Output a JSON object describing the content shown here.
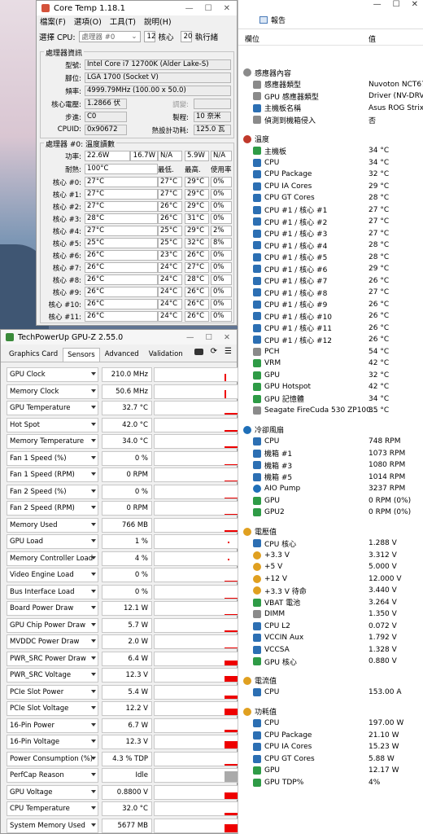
{
  "coretemp": {
    "title": "Core Temp 1.18.1",
    "menu": [
      "檔案(F)",
      "選項(O)",
      "工具(T)",
      "說明(H)"
    ],
    "sel_label": "選擇 CPU:",
    "sel_value": "處理器 #0",
    "cores": "12",
    "cores_label": "核心",
    "threads": "20",
    "threads_label": "執行緒",
    "info_title": "處理器資訊",
    "model_l": "型號:",
    "model": "Intel Core i7 12700K (Alder Lake-S)",
    "socket_l": "腳位:",
    "socket": "LGA 1700 (Socket V)",
    "freq_l": "頻率:",
    "freq": "4999.79MHz (100.00 x 50.0)",
    "vid_l": "核心電壓:",
    "vid": "1.2866 伏",
    "mod_l": "調變:",
    "step_l": "步進:",
    "step": "C0",
    "lith_l": "製程:",
    "lith": "10 奈米",
    "cpuid_l": "CPUID:",
    "cpuid": "0x90672",
    "tdp_l": "熱設計功耗:",
    "tdp": "125.0 瓦",
    "temp_title": "處理器 #0: 溫度讀數",
    "power_l": "功率:",
    "power": [
      "22.6W",
      "16.7W",
      "N/A",
      "5.9W",
      "N/A"
    ],
    "tj_l": "耐熱:",
    "tj": "100°C",
    "hdr": [
      "最低.",
      "最高.",
      "使用率"
    ],
    "rows": [
      [
        "核心 #0:",
        "27°C",
        "27°C",
        "29°C",
        "0%"
      ],
      [
        "核心 #1:",
        "27°C",
        "27°C",
        "29°C",
        "0%"
      ],
      [
        "核心 #2:",
        "27°C",
        "26°C",
        "29°C",
        "0%"
      ],
      [
        "核心 #3:",
        "28°C",
        "26°C",
        "31°C",
        "0%"
      ],
      [
        "核心 #4:",
        "27°C",
        "25°C",
        "29°C",
        "2%"
      ],
      [
        "核心 #5:",
        "25°C",
        "25°C",
        "32°C",
        "8%"
      ],
      [
        "核心 #6:",
        "26°C",
        "23°C",
        "26°C",
        "0%"
      ],
      [
        "核心 #7:",
        "26°C",
        "24°C",
        "27°C",
        "0%"
      ],
      [
        "核心 #8:",
        "26°C",
        "24°C",
        "28°C",
        "0%"
      ],
      [
        "核心 #9:",
        "26°C",
        "24°C",
        "26°C",
        "0%"
      ],
      [
        "核心 #10:",
        "26°C",
        "24°C",
        "26°C",
        "0%"
      ],
      [
        "核心 #11:",
        "26°C",
        "24°C",
        "26°C",
        "0%"
      ]
    ]
  },
  "gpuz": {
    "title": "TechPowerUp GPU-Z 2.55.0",
    "tabs": [
      "Graphics Card",
      "Sensors",
      "Advanced",
      "Validation"
    ],
    "sensors": [
      {
        "n": "GPU Clock",
        "v": "210.0 MHz",
        "g": 0.55,
        "k": "spk"
      },
      {
        "n": "Memory Clock",
        "v": "50.6 MHz",
        "g": 0.6,
        "k": "spk"
      },
      {
        "n": "GPU Temperature",
        "v": "32.7 °C",
        "g": 0.1,
        "k": "ln"
      },
      {
        "n": "Hot Spot",
        "v": "42.0 °C",
        "g": 0.12,
        "k": "ln"
      },
      {
        "n": "Memory Temperature",
        "v": "34.0 °C",
        "g": 0.1,
        "k": "ln"
      },
      {
        "n": "Fan 1 Speed (%)",
        "v": "0 %",
        "g": 0,
        "k": "ln"
      },
      {
        "n": "Fan 1 Speed (RPM)",
        "v": "0 RPM",
        "g": 0,
        "k": "ln"
      },
      {
        "n": "Fan 2 Speed (%)",
        "v": "0 %",
        "g": 0,
        "k": "ln"
      },
      {
        "n": "Fan 2 Speed (RPM)",
        "v": "0 RPM",
        "g": 0,
        "k": "ln"
      },
      {
        "n": "Memory Used",
        "v": "766 MB",
        "g": 0.1,
        "k": "ln"
      },
      {
        "n": "GPU Load",
        "v": "1 %",
        "g": 0.05,
        "k": "dot"
      },
      {
        "n": "Memory Controller Load",
        "v": "4 %",
        "g": 0.05,
        "k": "dot"
      },
      {
        "n": "Video Engine Load",
        "v": "0 %",
        "g": 0,
        "k": "ln"
      },
      {
        "n": "Bus Interface Load",
        "v": "0 %",
        "g": 0,
        "k": "ln"
      },
      {
        "n": "Board Power Draw",
        "v": "12.1 W",
        "g": 0.08,
        "k": "ln"
      },
      {
        "n": "GPU Chip Power Draw",
        "v": "5.7 W",
        "g": 0.08,
        "k": "ln"
      },
      {
        "n": "MVDDC Power Draw",
        "v": "2.0 W",
        "g": 0.08,
        "k": "ln"
      },
      {
        "n": "PWR_SRC Power Draw",
        "v": "6.4 W",
        "g": 0.35,
        "k": "blk"
      },
      {
        "n": "PWR_SRC Voltage",
        "v": "12.3 V",
        "g": 0.45,
        "k": "blk"
      },
      {
        "n": "PCIe Slot Power",
        "v": "5.4 W",
        "g": 0.2,
        "k": "ln"
      },
      {
        "n": "PCIe Slot Voltage",
        "v": "12.2 V",
        "g": 0.5,
        "k": "blk"
      },
      {
        "n": "16-Pin Power",
        "v": "6.7 W",
        "g": 0.15,
        "k": "ln"
      },
      {
        "n": "16-Pin Voltage",
        "v": "12.3 V",
        "g": 0.55,
        "k": "blk"
      },
      {
        "n": "Power Consumption (%)",
        "v": "4.3 % TDP",
        "g": 0.1,
        "k": "ln"
      },
      {
        "n": "PerfCap Reason",
        "v": "Idle",
        "g": 0.8,
        "k": "gray"
      },
      {
        "n": "GPU Voltage",
        "v": "0.8800 V",
        "g": 0.45,
        "k": "blk"
      },
      {
        "n": "CPU Temperature",
        "v": "32.0 °C",
        "g": 0.2,
        "k": "ln"
      },
      {
        "n": "System Memory Used",
        "v": "5677 MB",
        "g": 0.6,
        "k": "blk"
      }
    ]
  },
  "hwinfo": {
    "report": "報告",
    "col_sensor": "感測器",
    "col_value": "值",
    "top_fields": "欄位",
    "top_value": "值",
    "items": [
      {
        "t": "sec",
        "n": "感應器內容",
        "v": "",
        "i": "gray"
      },
      {
        "n": "感應器類型",
        "v": "Nuvoton NCT679",
        "i": "gray"
      },
      {
        "n": "GPU 感應器類型",
        "v": "Driver (NV-DRV)",
        "i": "gray"
      },
      {
        "n": "主機板名稱",
        "v": "Asus ROG Strix Z6",
        "i": "chip"
      },
      {
        "n": "偵測到機箱侵入",
        "v": "否",
        "i": "gray"
      },
      {
        "t": "gap"
      },
      {
        "t": "sec",
        "n": "溫度",
        "v": "",
        "i": "tmp"
      },
      {
        "n": "主機板",
        "v": "34 °C",
        "i": "grn"
      },
      {
        "n": "CPU",
        "v": "34 °C",
        "i": "chip"
      },
      {
        "n": "CPU Package",
        "v": "32 °C",
        "i": "chip"
      },
      {
        "n": "CPU IA Cores",
        "v": "29 °C",
        "i": "chip"
      },
      {
        "n": "CPU GT Cores",
        "v": "28 °C",
        "i": "chip"
      },
      {
        "n": "CPU #1 / 核心 #1",
        "v": "27 °C",
        "i": "chip"
      },
      {
        "n": "CPU #1 / 核心 #2",
        "v": "27 °C",
        "i": "chip"
      },
      {
        "n": "CPU #1 / 核心 #3",
        "v": "27 °C",
        "i": "chip"
      },
      {
        "n": "CPU #1 / 核心 #4",
        "v": "28 °C",
        "i": "chip"
      },
      {
        "n": "CPU #1 / 核心 #5",
        "v": "28 °C",
        "i": "chip"
      },
      {
        "n": "CPU #1 / 核心 #6",
        "v": "29 °C",
        "i": "chip"
      },
      {
        "n": "CPU #1 / 核心 #7",
        "v": "26 °C",
        "i": "chip"
      },
      {
        "n": "CPU #1 / 核心 #8",
        "v": "27 °C",
        "i": "chip"
      },
      {
        "n": "CPU #1 / 核心 #9",
        "v": "26 °C",
        "i": "chip"
      },
      {
        "n": "CPU #1 / 核心 #10",
        "v": "26 °C",
        "i": "chip"
      },
      {
        "n": "CPU #1 / 核心 #11",
        "v": "26 °C",
        "i": "chip"
      },
      {
        "n": "CPU #1 / 核心 #12",
        "v": "26 °C",
        "i": "chip"
      },
      {
        "n": "PCH",
        "v": "54 °C",
        "i": "gray"
      },
      {
        "n": "VRM",
        "v": "42 °C",
        "i": "grn"
      },
      {
        "n": "GPU",
        "v": "32 °C",
        "i": "grn"
      },
      {
        "n": "GPU Hotspot",
        "v": "42 °C",
        "i": "grn"
      },
      {
        "n": "GPU 記憶體",
        "v": "34 °C",
        "i": "grn"
      },
      {
        "n": "Seagate FireCuda 530 ZP100...",
        "v": "35 °C",
        "i": "gray"
      },
      {
        "t": "gap"
      },
      {
        "t": "sec",
        "n": "冷卻風扇",
        "v": "",
        "i": "fan"
      },
      {
        "n": "CPU",
        "v": "748 RPM",
        "i": "chip"
      },
      {
        "n": "機箱 #1",
        "v": "1073 RPM",
        "i": "chip"
      },
      {
        "n": "機箱 #3",
        "v": "1080 RPM",
        "i": "chip"
      },
      {
        "n": "機箱 #5",
        "v": "1014 RPM",
        "i": "chip"
      },
      {
        "n": "AIO Pump",
        "v": "3237 RPM",
        "i": "fan"
      },
      {
        "n": "GPU",
        "v": "0 RPM  (0%)",
        "i": "grn"
      },
      {
        "n": "GPU2",
        "v": "0 RPM  (0%)",
        "i": "grn"
      },
      {
        "t": "gap"
      },
      {
        "t": "sec",
        "n": "電壓值",
        "v": "",
        "i": "pw"
      },
      {
        "n": "CPU 核心",
        "v": "1.288 V",
        "i": "chip"
      },
      {
        "n": "+3.3 V",
        "v": "3.312 V",
        "i": "pw"
      },
      {
        "n": "+5 V",
        "v": "5.000 V",
        "i": "pw"
      },
      {
        "n": "+12 V",
        "v": "12.000 V",
        "i": "pw"
      },
      {
        "n": "+3.3 V 待命",
        "v": "3.440 V",
        "i": "pw"
      },
      {
        "n": "VBAT 電池",
        "v": "3.264 V",
        "i": "grn"
      },
      {
        "n": "DIMM",
        "v": "1.350 V",
        "i": "gray"
      },
      {
        "n": "CPU L2",
        "v": "0.072 V",
        "i": "chip"
      },
      {
        "n": "VCCIN Aux",
        "v": "1.792 V",
        "i": "chip"
      },
      {
        "n": "VCCSA",
        "v": "1.328 V",
        "i": "chip"
      },
      {
        "n": "GPU 核心",
        "v": "0.880 V",
        "i": "grn"
      },
      {
        "t": "gap"
      },
      {
        "t": "sec",
        "n": "電流值",
        "v": "",
        "i": "pw"
      },
      {
        "n": "CPU",
        "v": "153.00 A",
        "i": "chip"
      },
      {
        "t": "gap"
      },
      {
        "t": "sec",
        "n": "功耗值",
        "v": "",
        "i": "pw"
      },
      {
        "n": "CPU",
        "v": "197.00 W",
        "i": "chip"
      },
      {
        "n": "CPU Package",
        "v": "21.10 W",
        "i": "chip"
      },
      {
        "n": "CPU IA Cores",
        "v": "15.23 W",
        "i": "chip"
      },
      {
        "n": "CPU GT Cores",
        "v": "5.88 W",
        "i": "chip"
      },
      {
        "n": "GPU",
        "v": "12.17 W",
        "i": "grn"
      },
      {
        "n": "GPU TDP%",
        "v": "4%",
        "i": "grn"
      }
    ]
  }
}
